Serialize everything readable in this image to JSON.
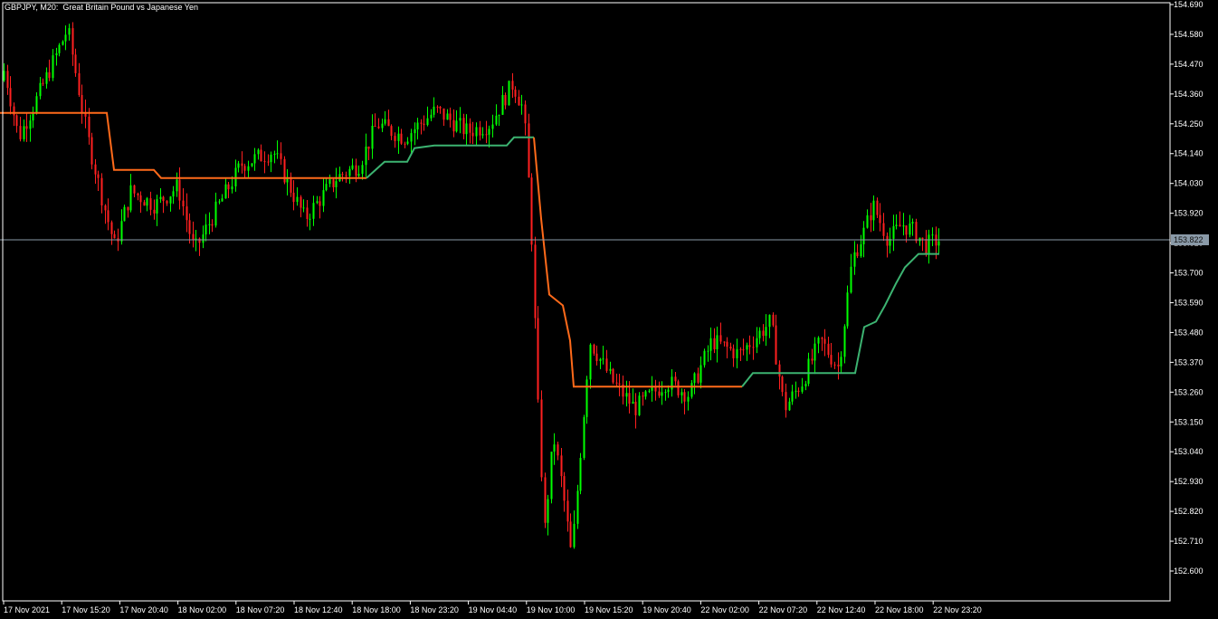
{
  "header": {
    "symbol_timeframe": "GBPJPY, M20:",
    "description": "Great Britain Pound vs Japanese Yen"
  },
  "price_axis": {
    "labels": [
      "154.690",
      "154.580",
      "154.470",
      "154.360",
      "154.250",
      "154.140",
      "154.030",
      "153.920",
      "153.810",
      "153.700",
      "153.590",
      "153.480",
      "153.370",
      "153.260",
      "153.150",
      "153.040",
      "152.930",
      "152.820",
      "152.710",
      "152.600"
    ],
    "current_price_label": "153.822"
  },
  "time_axis": {
    "labels": [
      "17 Nov 2021",
      "17 Nov 15:20",
      "17 Nov 20:40",
      "18 Nov 02:00",
      "18 Nov 07:20",
      "18 Nov 12:40",
      "18 Nov 18:00",
      "18 Nov 23:20",
      "19 Nov 04:40",
      "19 Nov 10:00",
      "19 Nov 15:20",
      "19 Nov 20:40",
      "22 Nov 02:00",
      "22 Nov 07:20",
      "22 Nov 12:40",
      "22 Nov 18:00",
      "22 Nov 23:20"
    ]
  },
  "colors": {
    "background": "#000000",
    "axis": "#ffffff",
    "bull_candle": "#00ff00",
    "bear_candle": "#ff2020",
    "trail_down": "#ff6a1a",
    "trail_up": "#3cb371",
    "price_line": "#8a9aa8",
    "price_badge": "#8a9aa8"
  },
  "chart_data": {
    "type": "candlestick",
    "symbol": "GBPJPY",
    "timeframe": "M20",
    "title": "Great Britain Pound vs Japanese Yen",
    "ylim": [
      152.547,
      154.7
    ],
    "current_price": 153.822,
    "price_path_keyframes": [
      {
        "x": 0,
        "y": 154.37
      },
      {
        "x": 8,
        "y": 154.45
      },
      {
        "x": 24,
        "y": 154.2
      },
      {
        "x": 45,
        "y": 154.35
      },
      {
        "x": 78,
        "y": 154.6
      },
      {
        "x": 100,
        "y": 154.2
      },
      {
        "x": 118,
        "y": 153.95
      },
      {
        "x": 130,
        "y": 153.8
      },
      {
        "x": 148,
        "y": 154.0
      },
      {
        "x": 175,
        "y": 153.95
      },
      {
        "x": 200,
        "y": 154.02
      },
      {
        "x": 218,
        "y": 153.78
      },
      {
        "x": 245,
        "y": 153.95
      },
      {
        "x": 270,
        "y": 154.1
      },
      {
        "x": 305,
        "y": 154.15
      },
      {
        "x": 340,
        "y": 153.9
      },
      {
        "x": 375,
        "y": 154.05
      },
      {
        "x": 400,
        "y": 154.1
      },
      {
        "x": 420,
        "y": 154.25
      },
      {
        "x": 450,
        "y": 154.2
      },
      {
        "x": 485,
        "y": 154.3
      },
      {
        "x": 520,
        "y": 154.22
      },
      {
        "x": 545,
        "y": 154.25
      },
      {
        "x": 570,
        "y": 154.4
      },
      {
        "x": 582,
        "y": 154.3
      },
      {
        "x": 590,
        "y": 153.9
      },
      {
        "x": 598,
        "y": 153.2
      },
      {
        "x": 605,
        "y": 152.75
      },
      {
        "x": 615,
        "y": 153.1
      },
      {
        "x": 625,
        "y": 152.9
      },
      {
        "x": 635,
        "y": 152.65
      },
      {
        "x": 645,
        "y": 153.05
      },
      {
        "x": 655,
        "y": 153.45
      },
      {
        "x": 680,
        "y": 153.3
      },
      {
        "x": 705,
        "y": 153.2
      },
      {
        "x": 740,
        "y": 153.3
      },
      {
        "x": 765,
        "y": 153.25
      },
      {
        "x": 790,
        "y": 153.45
      },
      {
        "x": 820,
        "y": 153.4
      },
      {
        "x": 855,
        "y": 153.52
      },
      {
        "x": 870,
        "y": 153.2
      },
      {
        "x": 890,
        "y": 153.3
      },
      {
        "x": 910,
        "y": 153.45
      },
      {
        "x": 930,
        "y": 153.35
      },
      {
        "x": 945,
        "y": 153.75
      },
      {
        "x": 958,
        "y": 153.85
      },
      {
        "x": 968,
        "y": 153.95
      },
      {
        "x": 985,
        "y": 153.82
      },
      {
        "x": 1000,
        "y": 153.88
      },
      {
        "x": 1015,
        "y": 153.85
      },
      {
        "x": 1025,
        "y": 153.8
      },
      {
        "x": 1040,
        "y": 153.822
      }
    ],
    "trailing_stop_segments": [
      {
        "trend": "down",
        "points": [
          [
            0,
            154.29
          ],
          [
            118,
            154.29
          ],
          [
            126,
            154.08
          ],
          [
            170,
            154.08
          ],
          [
            178,
            154.05
          ],
          [
            405,
            154.05
          ]
        ]
      },
      {
        "trend": "up",
        "points": [
          [
            405,
            154.05
          ],
          [
            425,
            154.11
          ],
          [
            450,
            154.11
          ],
          [
            458,
            154.16
          ],
          [
            480,
            154.17
          ],
          [
            560,
            154.17
          ],
          [
            568,
            154.2
          ],
          [
            590,
            154.2
          ]
        ]
      },
      {
        "trend": "down",
        "points": [
          [
            590,
            154.2
          ],
          [
            598,
            153.9
          ],
          [
            607,
            153.62
          ],
          [
            622,
            153.58
          ],
          [
            630,
            153.45
          ],
          [
            634,
            153.28
          ],
          [
            820,
            153.28
          ]
        ]
      },
      {
        "trend": "up",
        "points": [
          [
            820,
            153.28
          ],
          [
            832,
            153.33
          ],
          [
            945,
            153.33
          ],
          [
            955,
            153.5
          ],
          [
            968,
            153.52
          ],
          [
            978,
            153.58
          ],
          [
            990,
            153.66
          ],
          [
            1000,
            153.72
          ],
          [
            1015,
            153.77
          ],
          [
            1038,
            153.77
          ]
        ]
      }
    ]
  }
}
